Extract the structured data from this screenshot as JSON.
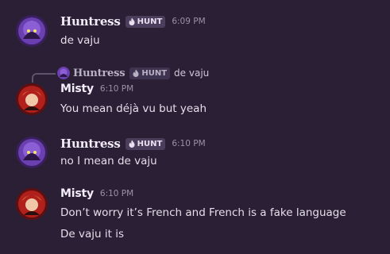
{
  "messages": [
    {
      "author": "Huntress",
      "tag": "HUNT",
      "time": "6:09 PM",
      "lines": [
        "de vaju"
      ]
    },
    {
      "reply_to": {
        "author": "Huntress",
        "tag": "HUNT",
        "text": "de vaju"
      },
      "author": "Misty",
      "time": "6:10 PM",
      "lines": [
        "You mean déjà vu but yeah"
      ]
    },
    {
      "author": "Huntress",
      "tag": "HUNT",
      "time": "6:10 PM",
      "lines": [
        "no I mean de vaju"
      ]
    },
    {
      "author": "Misty",
      "time": "6:10 PM",
      "lines": [
        "Don’t worry it’s French and French is a fake language",
        "De vaju it is"
      ]
    }
  ],
  "colors": {
    "background": "#2a1f35",
    "name": "#f2edf8",
    "text": "#e4dfea",
    "timestamp": "#9a92a6",
    "tag_background": "#4b3d5c",
    "huntress_avatar": "#6a3fb0",
    "misty_avatar": "#b0201c"
  },
  "icons": {
    "huntress_avatar": "purple-ghost-avatar",
    "misty_avatar": "red-character-avatar",
    "tag_icon": "flame-icon"
  }
}
